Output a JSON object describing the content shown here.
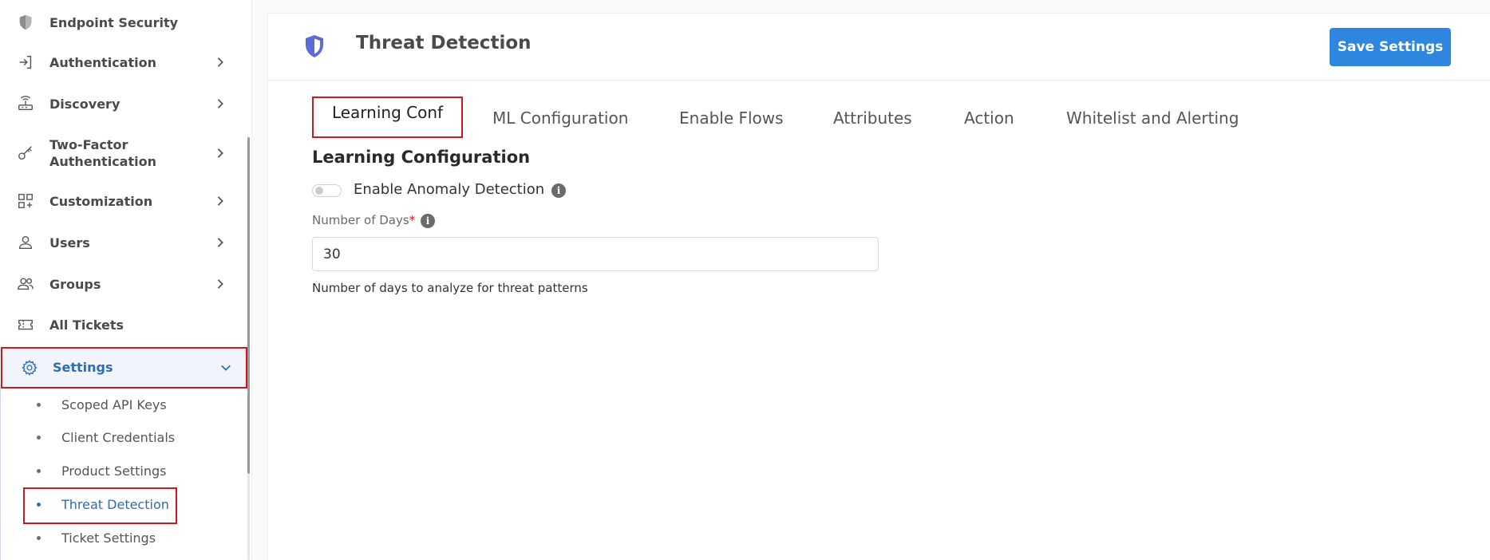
{
  "sidebar": {
    "items": [
      {
        "id": "endpoint-security",
        "label": "Endpoint Security",
        "icon": "shield-icon",
        "chevron": false
      },
      {
        "id": "authentication",
        "label": "Authentication",
        "icon": "login-icon",
        "chevron": true
      },
      {
        "id": "discovery",
        "label": "Discovery",
        "icon": "router-icon",
        "chevron": true
      },
      {
        "id": "two-factor",
        "label_line1": "Two-Factor",
        "label_line2": "Authentication",
        "icon": "key-icon",
        "chevron": true
      },
      {
        "id": "customization",
        "label": "Customization",
        "icon": "grid-plus-icon",
        "chevron": true
      },
      {
        "id": "users",
        "label": "Users",
        "icon": "user-icon",
        "chevron": true
      },
      {
        "id": "groups",
        "label": "Groups",
        "icon": "users-icon",
        "chevron": true
      },
      {
        "id": "all-tickets",
        "label": "All Tickets",
        "icon": "ticket-icon",
        "chevron": false
      },
      {
        "id": "settings",
        "label": "Settings",
        "icon": "gear-icon",
        "chevron": "down"
      }
    ],
    "settings_sub": [
      {
        "id": "scoped-api-keys",
        "label": "Scoped API Keys"
      },
      {
        "id": "client-credentials",
        "label": "Client Credentials"
      },
      {
        "id": "product-settings",
        "label": "Product Settings"
      },
      {
        "id": "threat-detection",
        "label": "Threat Detection",
        "active": true
      },
      {
        "id": "ticket-settings",
        "label": "Ticket Settings"
      }
    ]
  },
  "header": {
    "title": "Threat Detection",
    "icon": "shield-half-icon",
    "save_label": "Save Settings"
  },
  "tabs": [
    {
      "id": "learning-conf",
      "label": "Learning Conf",
      "active": true
    },
    {
      "id": "ml-configuration",
      "label": "ML Configuration"
    },
    {
      "id": "enable-flows",
      "label": "Enable Flows"
    },
    {
      "id": "attributes",
      "label": "Attributes"
    },
    {
      "id": "action",
      "label": "Action"
    },
    {
      "id": "whitelist-alerting",
      "label": "Whitelist and Alerting"
    }
  ],
  "form": {
    "section_title": "Learning Configuration",
    "toggle_label": "Enable Anomaly Detection",
    "toggle_on": false,
    "days_label": "Number of Days",
    "required_mark": "*",
    "days_value": "30",
    "days_help": "Number of days to analyze for threat patterns",
    "info_glyph": "i"
  },
  "colors": {
    "accent": "#2e86de",
    "active_text": "#2c6db5",
    "highlight_border": "#d0161e",
    "shield": "#5c6bd6"
  }
}
